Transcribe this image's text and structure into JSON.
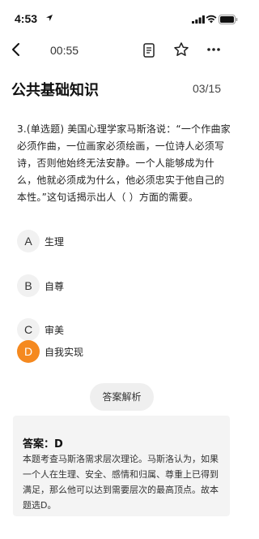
{
  "status_bar": {
    "time": "4:53",
    "icons": [
      "location-arrow-icon",
      "cell-signal-icon",
      "wifi-icon",
      "battery-icon"
    ]
  },
  "nav": {
    "timer": "00:55",
    "icons": [
      "back-icon",
      "answer-sheet-icon",
      "star-icon",
      "more-icon"
    ]
  },
  "header": {
    "subject": "公共基础知识",
    "progress": "03/15"
  },
  "question": {
    "text": "3.(单选题) 美国心理学家马斯洛说：“一个作曲家必须作曲，一位画家必须绘画，一位诗人必须写诗，否则他始终无法安静。一个人能够成为什么，他就必须成为什么，他必须忠实于他自己的本性。”这句话揭示出人（  ）方面的需要。"
  },
  "options": [
    {
      "letter": "A",
      "text": "生理"
    },
    {
      "letter": "B",
      "text": "自尊"
    },
    {
      "letter": "C",
      "text": "审美"
    },
    {
      "letter": "D",
      "text": "自我实现"
    }
  ],
  "selected_option": "D",
  "analysis_button": "答案解析",
  "answer": {
    "label": "答案：D",
    "explanation": "本题考查马斯洛需求层次理论。马斯洛认为，如果一个人在生理、安全、感情和归属、尊重上已得到满足，那么他可以达到需要层次的最高顶点。故本题选D。"
  },
  "colors": {
    "accent": "#f5891f",
    "option_bg": "#f1f1f1",
    "panel_bg": "#f4f4f4"
  }
}
